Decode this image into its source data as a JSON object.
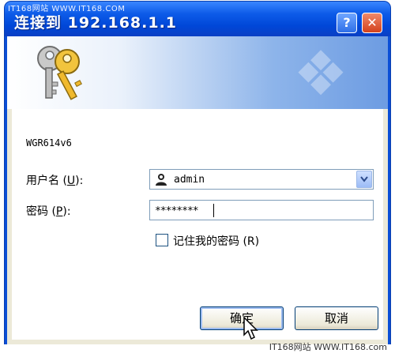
{
  "watermark": {
    "top": "IT168网站  WWW.IT168.COM",
    "bottom": "IT168网站 WWW.IT168.com"
  },
  "window": {
    "title": "连接到 192.168.1.1",
    "help_label": "?",
    "close_label": "✕"
  },
  "realm": "WGR614v6",
  "form": {
    "username_label_pre": "用户名 (",
    "username_key": "U",
    "username_label_post": "):",
    "username_value": "admin",
    "password_label_pre": "密码 (",
    "password_key": "P",
    "password_label_post": "):",
    "password_value": "********",
    "remember_label": "记住我的密码 (R)",
    "remember_checked": false
  },
  "buttons": {
    "ok": "确定",
    "cancel": "取消"
  },
  "icons": {
    "banner": "keys-icon",
    "user": "user-icon",
    "dropdown": "chevron-down-icon",
    "pointer": "mouse-pointer-icon"
  }
}
